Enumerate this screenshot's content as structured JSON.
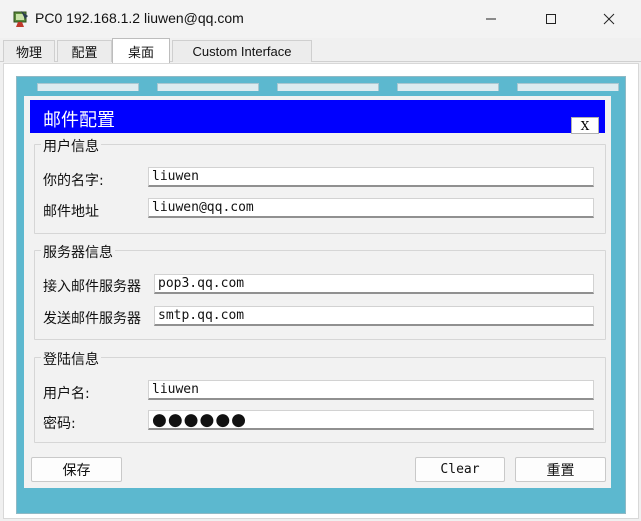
{
  "window": {
    "title": "PC0 192.168.1.2 liuwen@qq.com"
  },
  "tabs": [
    {
      "label": "物理",
      "active": false
    },
    {
      "label": "配置",
      "active": false
    },
    {
      "label": "桌面",
      "active": true
    },
    {
      "label": "Custom Interface",
      "active": false
    }
  ],
  "dialog": {
    "title": "邮件配置",
    "close_label": "X",
    "header_color": "#0000ff",
    "user_info": {
      "legend": "用户信息",
      "name_label": "你的名字:",
      "name_value": "liuwen",
      "email_label": "邮件地址",
      "email_value": "liuwen@qq.com"
    },
    "server_info": {
      "legend": "服务器信息",
      "incoming_label": "接入邮件服务器",
      "incoming_value": "pop3.qq.com",
      "outgoing_label": "发送邮件服务器",
      "outgoing_value": "smtp.qq.com"
    },
    "login_info": {
      "legend": "登陆信息",
      "username_label": "用户名:",
      "username_value": "liuwen",
      "password_label": "密码:",
      "password_value": "●●●●●●"
    },
    "buttons": {
      "save": "保存",
      "clear": "Clear",
      "reset": "重置"
    }
  },
  "colors": {
    "desktop_background": "#5cb8cf"
  }
}
